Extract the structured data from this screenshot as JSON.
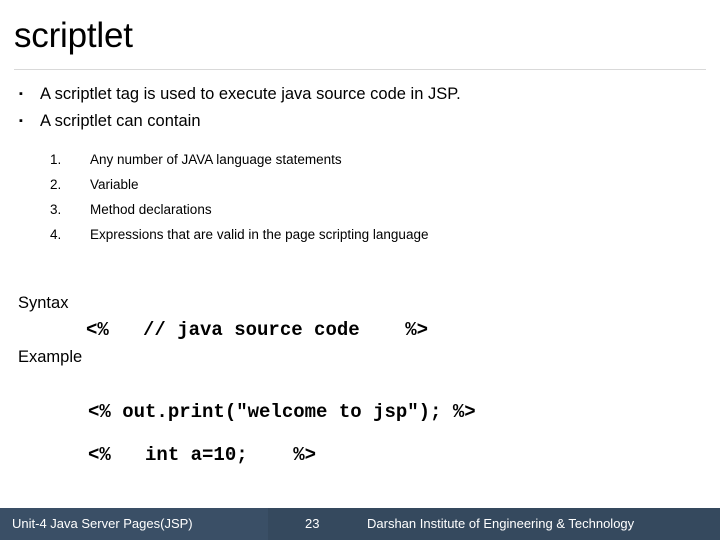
{
  "slide": {
    "title": "scriptlet",
    "bullet_marker": "▪",
    "bullets": [
      "A scriptlet tag is used to execute java source code in JSP.",
      "A scriptlet can contain"
    ],
    "numbered_items": [
      {
        "number": "1.",
        "text": "Any number of JAVA language statements"
      },
      {
        "number": "2.",
        "text": "Variable"
      },
      {
        "number": "3.",
        "text": "Method declarations"
      },
      {
        "number": "4.",
        "text": "Expressions that are valid in the page scripting language"
      }
    ],
    "syntax_label": "Syntax",
    "syntax_code": "<%   // java source code    %>",
    "example_label": "Example",
    "example_code_1": "<% out.print(\"welcome to jsp\"); %>",
    "example_code_2": "<%   int a=10;    %>"
  },
  "footer": {
    "left": "Unit-4 Java Server Pages(JSP)",
    "page_number": "23",
    "right": "Darshan Institute of Engineering & Technology",
    "background_color": "#35495e",
    "band_color": "#3a4f66",
    "text_color": "#ffffff"
  },
  "theme": {
    "background": "#ffffff",
    "text_color": "#000000",
    "rule_color": "#d9d9d9"
  }
}
